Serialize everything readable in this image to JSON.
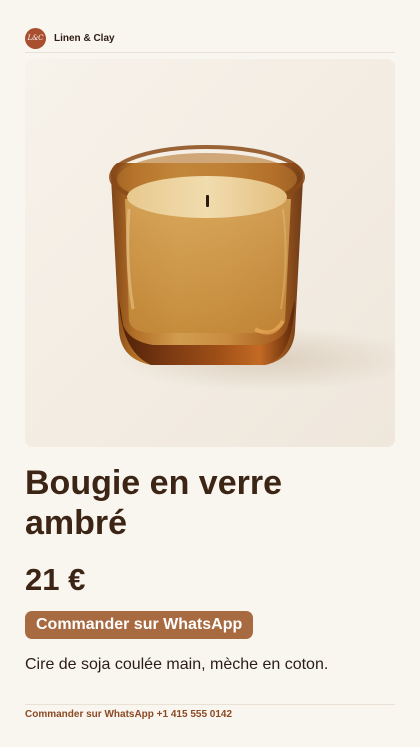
{
  "brand": {
    "logo_text": "L&C",
    "name": "Linen & Clay"
  },
  "product": {
    "image_subject": "amber glass candle",
    "title": "Bougie en verre ambré",
    "price": "21 €",
    "order_button_label": "Commander sur WhatsApp",
    "description": "Cire de soja coulée main, mèche en coton."
  },
  "footer": {
    "whatsapp_link": "Commander sur WhatsApp +1 415 555 0142"
  },
  "colors": {
    "background": "#f9f5ef",
    "logo_badge": "#a94e2f",
    "button": "#a86a40",
    "footer_link": "#8c4a24",
    "text_primary": "#3d2516"
  }
}
